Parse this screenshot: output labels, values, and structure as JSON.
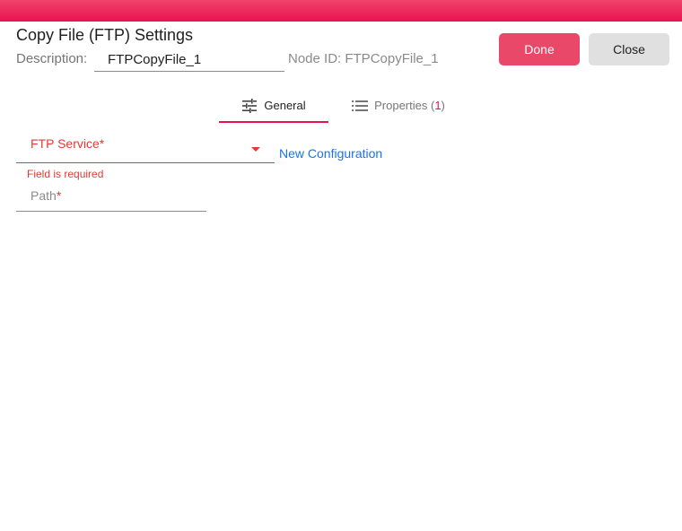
{
  "dialog": {
    "title": "Copy File (FTP) Settings",
    "description_label": "Description:",
    "description_value": "FTPCopyFile_1",
    "node_id_text": "Node ID: FTPCopyFile_1",
    "done_label": "Done",
    "close_label": "Close"
  },
  "tabs": [
    {
      "label": "General",
      "icon": "sliders-icon",
      "active": true
    },
    {
      "label": "Properties (",
      "count": "1",
      "suffix": ")",
      "icon": "list-icon",
      "active": false
    }
  ],
  "form": {
    "ftp_service": {
      "label": "FTP Service",
      "required_mark": "*",
      "error": "Field is required",
      "value": ""
    },
    "new_configuration_label": "New Configuration",
    "path": {
      "label": "Path",
      "required_mark": "*",
      "value": ""
    }
  },
  "colors": {
    "accent": "#e8124f",
    "done_button": "#ea4868",
    "error": "#e53935",
    "link": "#1a73e8"
  }
}
